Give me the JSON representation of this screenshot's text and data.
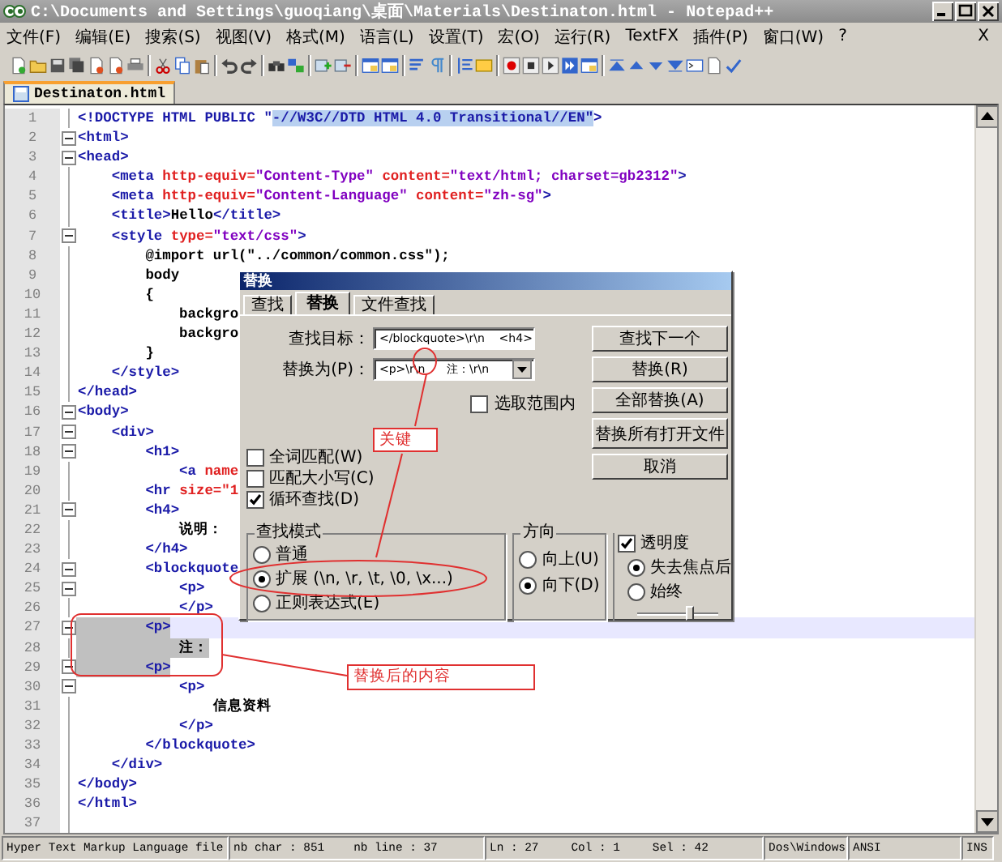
{
  "window": {
    "title": "C:\\Documents and Settings\\guoqiang\\桌面\\Materials\\Destinaton.html - Notepad++"
  },
  "menu": {
    "items": [
      "文件(F)",
      "编辑(E)",
      "搜索(S)",
      "视图(V)",
      "格式(M)",
      "语言(L)",
      "设置(T)",
      "宏(O)",
      "运行(R)",
      "TextFX",
      "插件(P)",
      "窗口(W)",
      "?"
    ],
    "close_glyph": "X"
  },
  "tabs": [
    {
      "label": "Destinaton.html",
      "selected": true
    }
  ],
  "editor": {
    "lines": [
      {
        "number": "1",
        "fold": false,
        "current": false,
        "selected": false,
        "tokens": [
          {
            "kind": "tag",
            "text": "<!DOCTYPE HTML PUBLIC \""
          },
          {
            "kind": "match",
            "text": "-//W3C//DTD HTML 4.0 Transitional//EN\""
          },
          {
            "kind": "tag",
            "text": ">"
          }
        ]
      },
      {
        "number": "2",
        "fold": true,
        "current": false,
        "selected": false,
        "tokens": [
          {
            "kind": "tag",
            "text": "<html>"
          }
        ]
      },
      {
        "number": "3",
        "fold": true,
        "current": false,
        "selected": false,
        "tokens": [
          {
            "kind": "tag",
            "text": "<head>"
          }
        ]
      },
      {
        "number": "4",
        "fold": false,
        "current": false,
        "selected": false,
        "tokens": [
          {
            "kind": "tag",
            "text": "    <meta"
          },
          {
            "kind": "attr",
            "text": " http-equiv="
          },
          {
            "kind": "value",
            "text": "\"Content-Type\""
          },
          {
            "kind": "attr",
            "text": " content="
          },
          {
            "kind": "value",
            "text": "\"text/html; charset=gb2312\""
          },
          {
            "kind": "tag",
            "text": ">"
          }
        ]
      },
      {
        "number": "5",
        "fold": false,
        "current": false,
        "selected": false,
        "tokens": [
          {
            "kind": "tag",
            "text": "    <meta"
          },
          {
            "kind": "attr",
            "text": " http-equiv="
          },
          {
            "kind": "value",
            "text": "\"Content-Language\""
          },
          {
            "kind": "attr",
            "text": " content="
          },
          {
            "kind": "value",
            "text": "\"zh-sg\""
          },
          {
            "kind": "tag",
            "text": ">"
          }
        ]
      },
      {
        "number": "6",
        "fold": false,
        "current": false,
        "selected": false,
        "tokens": [
          {
            "kind": "tag",
            "text": "    <title>"
          },
          {
            "kind": "text",
            "text": "Hello"
          },
          {
            "kind": "tag",
            "text": "</title>"
          }
        ]
      },
      {
        "number": "7",
        "fold": true,
        "current": false,
        "selected": false,
        "tokens": [
          {
            "kind": "tag",
            "text": "    <style"
          },
          {
            "kind": "attr",
            "text": " type="
          },
          {
            "kind": "value",
            "text": "\"text/css\""
          },
          {
            "kind": "tag",
            "text": ">"
          }
        ]
      },
      {
        "number": "8",
        "fold": false,
        "current": false,
        "selected": false,
        "tokens": [
          {
            "kind": "css",
            "text": "        @import url(\"../common/common.css\");"
          }
        ]
      },
      {
        "number": "9",
        "fold": false,
        "current": false,
        "selected": false,
        "tokens": [
          {
            "kind": "css",
            "text": "        body"
          }
        ]
      },
      {
        "number": "10",
        "fold": false,
        "current": false,
        "selected": false,
        "tokens": [
          {
            "kind": "css",
            "text": "        {"
          }
        ]
      },
      {
        "number": "11",
        "fold": false,
        "current": false,
        "selected": false,
        "tokens": [
          {
            "kind": "css",
            "text": "            backgro"
          }
        ]
      },
      {
        "number": "12",
        "fold": false,
        "current": false,
        "selected": false,
        "tokens": [
          {
            "kind": "css",
            "text": "            backgro"
          }
        ]
      },
      {
        "number": "13",
        "fold": false,
        "current": false,
        "selected": false,
        "tokens": [
          {
            "kind": "css",
            "text": "        }"
          }
        ]
      },
      {
        "number": "14",
        "fold": false,
        "current": false,
        "selected": false,
        "tokens": [
          {
            "kind": "tag",
            "text": "    </style>"
          }
        ]
      },
      {
        "number": "15",
        "fold": false,
        "current": false,
        "selected": false,
        "tokens": [
          {
            "kind": "tag",
            "text": "</head>"
          }
        ]
      },
      {
        "number": "16",
        "fold": true,
        "current": false,
        "selected": false,
        "tokens": [
          {
            "kind": "tag",
            "text": "<body>"
          }
        ]
      },
      {
        "number": "17",
        "fold": true,
        "current": false,
        "selected": false,
        "tokens": [
          {
            "kind": "tag",
            "text": "    <div>"
          }
        ]
      },
      {
        "number": "18",
        "fold": true,
        "current": false,
        "selected": false,
        "tokens": [
          {
            "kind": "tag",
            "text": "        <h1>"
          }
        ]
      },
      {
        "number": "19",
        "fold": false,
        "current": false,
        "selected": false,
        "tokens": [
          {
            "kind": "tag",
            "text": "            <a"
          },
          {
            "kind": "attr",
            "text": " name"
          }
        ]
      },
      {
        "number": "20",
        "fold": false,
        "current": false,
        "selected": false,
        "tokens": [
          {
            "kind": "tag",
            "text": "        <hr"
          },
          {
            "kind": "attr",
            "text": " size=\"1"
          }
        ]
      },
      {
        "number": "21",
        "fold": true,
        "current": false,
        "selected": false,
        "tokens": [
          {
            "kind": "tag",
            "text": "        <h4>"
          }
        ]
      },
      {
        "number": "22",
        "fold": false,
        "current": false,
        "selected": false,
        "tokens": [
          {
            "kind": "text",
            "text": "            说明："
          }
        ]
      },
      {
        "number": "23",
        "fold": false,
        "current": false,
        "selected": false,
        "tokens": [
          {
            "kind": "tag",
            "text": "        </h4>"
          }
        ]
      },
      {
        "number": "24",
        "fold": true,
        "current": false,
        "selected": false,
        "tokens": [
          {
            "kind": "tag",
            "text": "        <blockquote"
          }
        ]
      },
      {
        "number": "25",
        "fold": true,
        "current": false,
        "selected": false,
        "tokens": [
          {
            "kind": "tag",
            "text": "            <p>"
          }
        ]
      },
      {
        "number": "26",
        "fold": false,
        "current": false,
        "selected": false,
        "tokens": [
          {
            "kind": "tag",
            "text": "            </p>"
          }
        ]
      },
      {
        "number": "27",
        "fold": true,
        "current": true,
        "selected": true,
        "tokens": [
          {
            "kind": "tag",
            "text": "        <p>"
          }
        ]
      },
      {
        "number": "28",
        "fold": false,
        "current": false,
        "selected": true,
        "tokens": [
          {
            "kind": "text",
            "text": "            注："
          }
        ]
      },
      {
        "number": "29",
        "fold": true,
        "current": false,
        "selected": true,
        "tokens": [
          {
            "kind": "tag",
            "text": "        <p>"
          }
        ]
      },
      {
        "number": "30",
        "fold": true,
        "current": false,
        "selected": false,
        "tokens": [
          {
            "kind": "tag",
            "text": "            <p>"
          }
        ]
      },
      {
        "number": "31",
        "fold": false,
        "current": false,
        "selected": false,
        "tokens": [
          {
            "kind": "text",
            "text": "                信息资料"
          }
        ]
      },
      {
        "number": "32",
        "fold": false,
        "current": false,
        "selected": false,
        "tokens": [
          {
            "kind": "tag",
            "text": "            </p>"
          }
        ]
      },
      {
        "number": "33",
        "fold": false,
        "current": false,
        "selected": false,
        "tokens": [
          {
            "kind": "tag",
            "text": "        </blockquote>"
          }
        ]
      },
      {
        "number": "34",
        "fold": false,
        "current": false,
        "selected": false,
        "tokens": [
          {
            "kind": "tag",
            "text": "    </div>"
          }
        ]
      },
      {
        "number": "35",
        "fold": false,
        "current": false,
        "selected": false,
        "tokens": [
          {
            "kind": "tag",
            "text": "</body>"
          }
        ]
      },
      {
        "number": "36",
        "fold": false,
        "current": false,
        "selected": false,
        "tokens": [
          {
            "kind": "tag",
            "text": "</html>"
          }
        ]
      },
      {
        "number": "37",
        "fold": false,
        "current": false,
        "selected": false
      }
    ]
  },
  "dialog": {
    "title": "替换",
    "tabs": [
      {
        "label": "查找",
        "selected": false
      },
      {
        "label": "替换",
        "selected": true
      },
      {
        "label": "文件查找",
        "selected": false
      }
    ],
    "fields": [
      {
        "label": "查找目标：",
        "value": "</blockquote>\\r\\n    <h4>"
      },
      {
        "label": "替换为(P)：",
        "value": "<p>\\r\\n      注：\\r\\n"
      }
    ],
    "scope": {
      "label": "选取范围内",
      "checked": false
    },
    "buttons": [
      "查找下一个",
      "替换(R)",
      "全部替换(A)",
      "替换所有打开文件",
      "取消"
    ],
    "options": [
      {
        "label": "全词匹配(W)",
        "checked": false
      },
      {
        "label": "匹配大小写(C)",
        "checked": false
      },
      {
        "label": "循环查找(D)",
        "checked": true
      }
    ],
    "search_mode": {
      "title": "查找模式",
      "options": [
        {
          "label": "普通",
          "selected": false
        },
        {
          "label": "扩展 (\\n, \\r, \\t, \\0, \\x...)",
          "selected": true
        },
        {
          "label": "正则表达式(E)",
          "selected": false
        }
      ]
    },
    "direction": {
      "title": "方向",
      "options": [
        {
          "label": "向上(U)",
          "selected": false
        },
        {
          "label": "向下(D)",
          "selected": true
        }
      ]
    },
    "transparency": {
      "label": "透明度",
      "checked": true,
      "options": [
        {
          "label": "失去焦点后",
          "selected": true
        },
        {
          "label": "始终",
          "selected": false
        }
      ],
      "level": 0.65
    }
  },
  "annotations": [
    {
      "kind": "key",
      "text": "关键"
    },
    {
      "kind": "result",
      "text": "替换后的内容"
    }
  ],
  "status_bar": [
    {
      "texts": [
        "Hyper Text Markup Language file"
      ]
    },
    {
      "texts": [
        "nb char : 851",
        "nb line : 37"
      ]
    },
    {
      "texts": [
        "Ln : 27",
        "Col : 1",
        "Sel : 42"
      ]
    },
    {
      "texts": [
        "Dos\\Windows"
      ]
    },
    {
      "texts": [
        "ANSI"
      ]
    },
    {
      "texts": [
        "INS"
      ]
    }
  ]
}
